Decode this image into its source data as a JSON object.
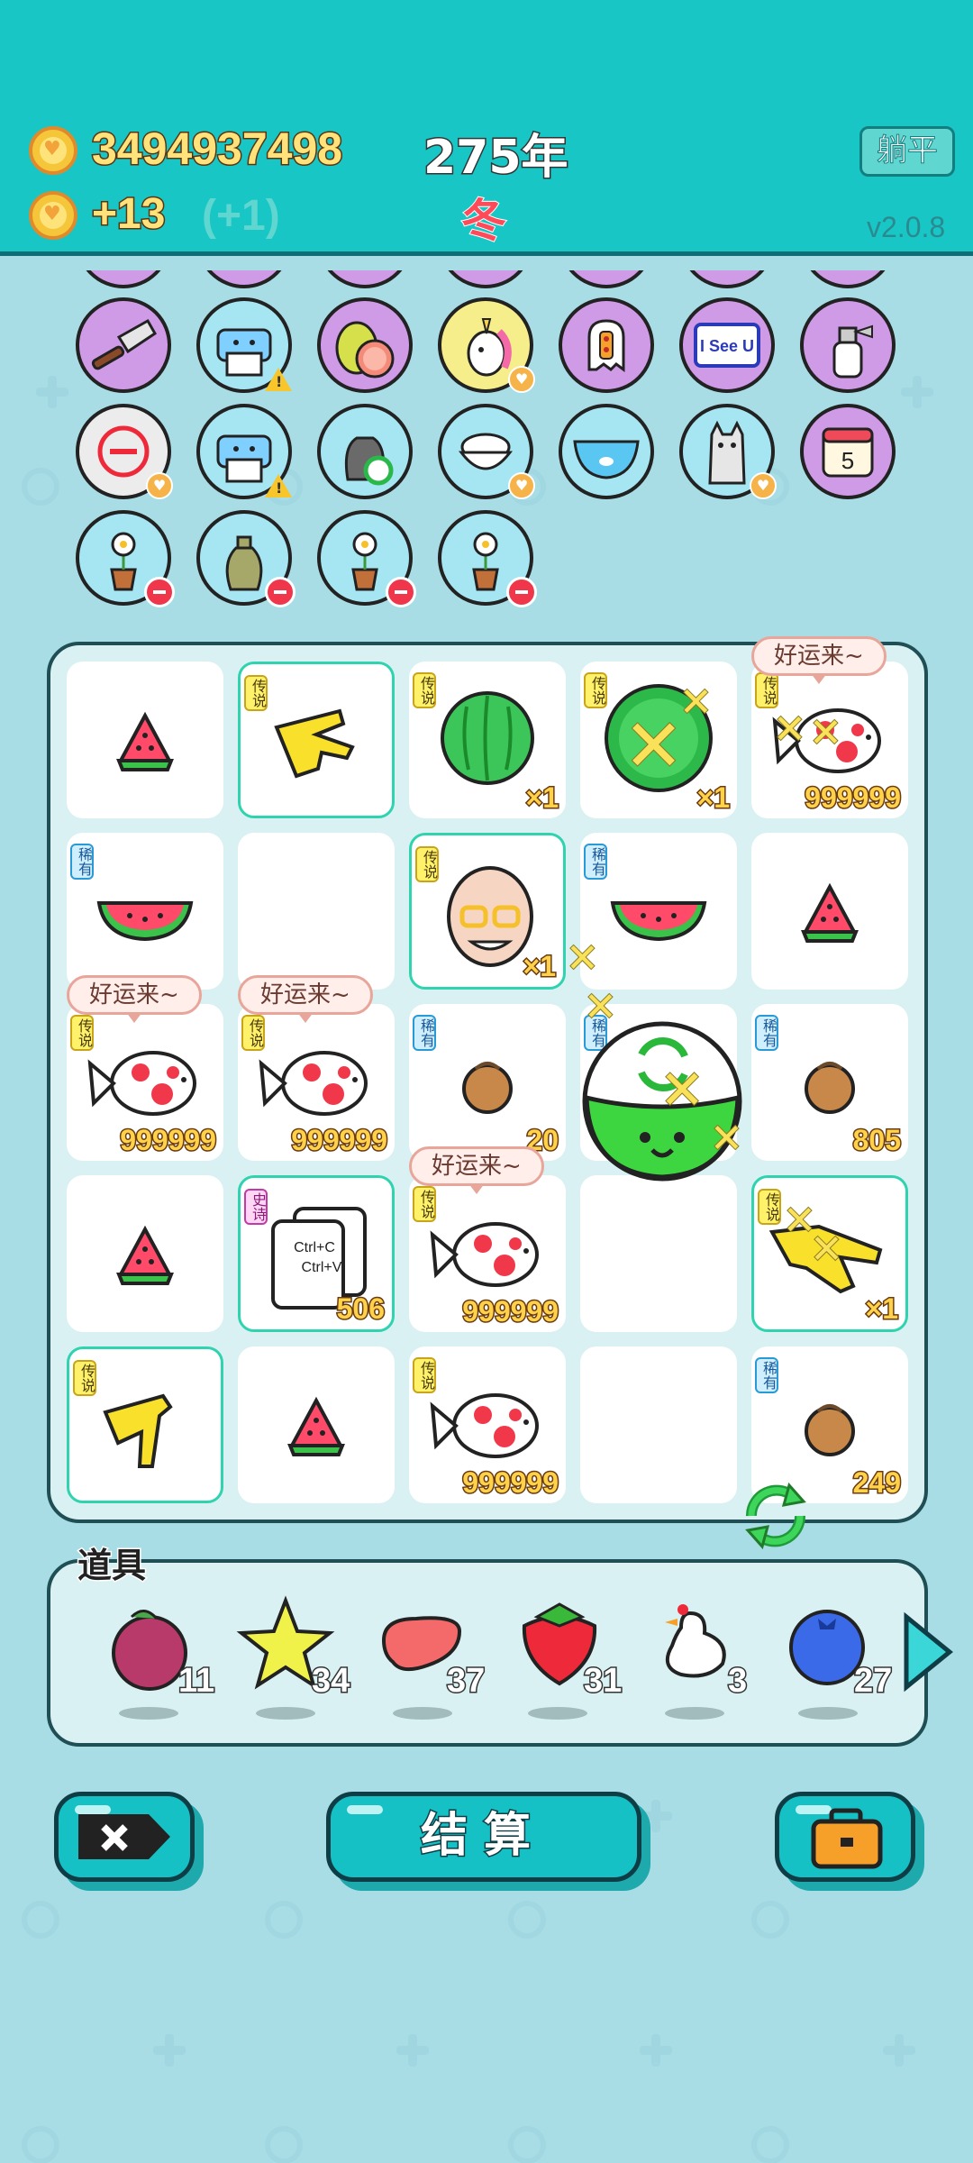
{
  "header": {
    "gold_total": "3494937498",
    "gold_gain": "+13",
    "gold_gain_bonus": "(+1)",
    "year_label": "275年",
    "season_label": "冬",
    "lie_flat_label": "躺平",
    "version": "v2.0.8"
  },
  "items_rows": [
    [
      "cleaver-icon",
      "printer-icon",
      "pomelo-icon",
      "unicorn-icon",
      "ghost-lantern-icon",
      "i-see-u-sign-icon",
      "spray-bottle-icon"
    ],
    [
      "no-entry-icon",
      "printer-icon",
      "recycle-bag-icon",
      "rice-bowl-icon",
      "fish-tank-icon",
      "husky-dog-icon",
      "calendar-icon"
    ],
    [
      "flower-pot-icon",
      "money-sack-icon",
      "flower-pot-icon",
      "flower-pot-icon"
    ]
  ],
  "items_labels": {
    "i_see_u": "I See U",
    "calendar_day": "5"
  },
  "board": {
    "rows": [
      [
        {
          "icon": "watermelon-slice-icon"
        },
        {
          "icon": "hand-pointing-icon",
          "tag": "传说",
          "tag_type": "leg",
          "glow": true
        },
        {
          "icon": "watermelon-icon",
          "tag": "传说",
          "tag_type": "leg",
          "count": "×1"
        },
        {
          "icon": "green-watermelon-icon",
          "tag": "传说",
          "tag_type": "leg",
          "count": "×1"
        },
        {
          "icon": "koi-fish-icon",
          "tag": "传说",
          "tag_type": "leg",
          "count": "999999",
          "bubble": "好运来~"
        }
      ],
      [
        {
          "icon": "watermelon-slice-icon",
          "tag": "稀有",
          "tag_type": "rare"
        },
        {
          "icon": "empty"
        },
        {
          "icon": "old-man-face-icon",
          "tag": "传说",
          "tag_type": "leg",
          "glow": true,
          "count": "×1"
        },
        {
          "icon": "watermelon-slice-icon",
          "tag": "稀有",
          "tag_type": "rare"
        },
        {
          "icon": "watermelon-slice-icon"
        }
      ],
      [
        {
          "icon": "koi-fish-icon",
          "tag": "传说",
          "tag_type": "leg",
          "count": "999999",
          "bubble": "好运来~"
        },
        {
          "icon": "koi-fish-icon",
          "tag": "传说",
          "tag_type": "leg",
          "count": "999999",
          "bubble": "好运来~"
        },
        {
          "icon": "hazelnut-icon",
          "tag": "稀有",
          "tag_type": "rare",
          "count": "20"
        },
        {
          "icon": "slime-ball-icon",
          "tag": "稀有",
          "tag_type": "rare"
        },
        {
          "icon": "hazelnut-icon",
          "tag": "稀有",
          "tag_type": "rare",
          "count": "805"
        }
      ],
      [
        {
          "icon": "watermelon-slice-icon"
        },
        {
          "icon": "copy-paste-icon",
          "tag": "史诗",
          "tag_type": "epic",
          "glow": true,
          "count": "506"
        },
        {
          "icon": "koi-fish-icon",
          "tag": "传说",
          "tag_type": "leg",
          "count": "999999",
          "bubble": "好运来~"
        },
        {
          "icon": "empty"
        },
        {
          "icon": "hand-pointing-icon",
          "tag": "传说",
          "tag_type": "leg",
          "glow": true,
          "count": "×1"
        }
      ],
      [
        {
          "icon": "hand-pointing-down-icon",
          "tag": "传说",
          "tag_type": "leg",
          "glow": true
        },
        {
          "icon": "watermelon-slice-icon"
        },
        {
          "icon": "koi-fish-icon",
          "tag": "传说",
          "tag_type": "leg",
          "count": "999999"
        },
        {
          "icon": "empty"
        },
        {
          "icon": "hazelnut-icon",
          "tag": "稀有",
          "tag_type": "rare",
          "count": "249"
        }
      ]
    ],
    "copy_paste_text": [
      "Ctrl+C",
      "Ctrl+V"
    ]
  },
  "props": {
    "title": "道具",
    "items": [
      {
        "icon": "lychee-icon",
        "count": "11"
      },
      {
        "icon": "star-icon",
        "count": "34"
      },
      {
        "icon": "liver-icon",
        "count": "37"
      },
      {
        "icon": "strawberry-icon",
        "count": "31"
      },
      {
        "icon": "white-bird-icon",
        "count": "3"
      },
      {
        "icon": "blueberry-icon",
        "count": "27"
      }
    ]
  },
  "bottom": {
    "settle_label": "结算"
  },
  "colors": {
    "header": "#18c6c6",
    "background": "#a9dde6",
    "button": "#16c1c5",
    "count_text": "#ffd24a"
  }
}
